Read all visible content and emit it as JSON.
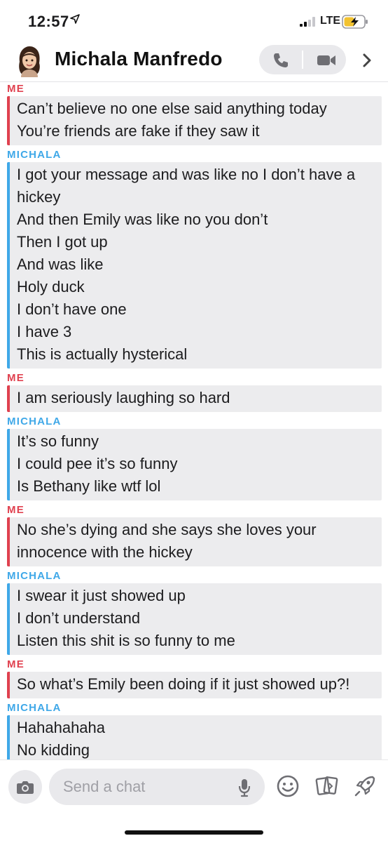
{
  "status_bar": {
    "time": "12:57",
    "network": "LTE"
  },
  "header": {
    "contact_name": "Michala  Manfredo"
  },
  "conversation": [
    {
      "sender": "ME",
      "side": "me",
      "messages": [
        "Can’t believe no one else said anything today",
        "You’re friends are fake if they saw it"
      ]
    },
    {
      "sender": "MICHALA",
      "side": "them",
      "messages": [
        "I got your message and was like no I don’t have a hickey",
        "And then Emily was like no you don’t",
        "Then I got up",
        "And was like",
        "Holy duck",
        "I don’t have one",
        "I have 3",
        "This is actually hysterical"
      ]
    },
    {
      "sender": "ME",
      "side": "me",
      "messages": [
        "I am seriously laughing so hard"
      ]
    },
    {
      "sender": "MICHALA",
      "side": "them",
      "messages": [
        "It’s so funny",
        "I could pee it’s so funny",
        "Is Bethany like wtf lol"
      ]
    },
    {
      "sender": "ME",
      "side": "me",
      "messages": [
        "No she’s dying and she says she loves your innocence with the hickey"
      ]
    },
    {
      "sender": "MICHALA",
      "side": "them",
      "messages": [
        "I swear it just showed up",
        "I don’t understand",
        "Listen this shit is so funny to me"
      ]
    },
    {
      "sender": "ME",
      "side": "me",
      "messages": [
        "So what’s Emily been doing if it just showed up?!"
      ]
    },
    {
      "sender": "MICHALA",
      "side": "them",
      "messages": [
        "Hahahahaha",
        "No kidding"
      ]
    }
  ],
  "input": {
    "placeholder": "Send a chat"
  },
  "colors": {
    "me": "#e0414f",
    "them": "#3fa8e8",
    "bubble_bg": "#ececee"
  },
  "icons": [
    "location-arrow-icon",
    "signal-icon",
    "battery-charging-icon",
    "bitmoji-avatar-icon",
    "phone-icon",
    "video-camera-icon",
    "chevron-right-icon",
    "camera-icon",
    "microphone-icon",
    "smiley-icon",
    "cards-icon",
    "rocket-icon"
  ]
}
